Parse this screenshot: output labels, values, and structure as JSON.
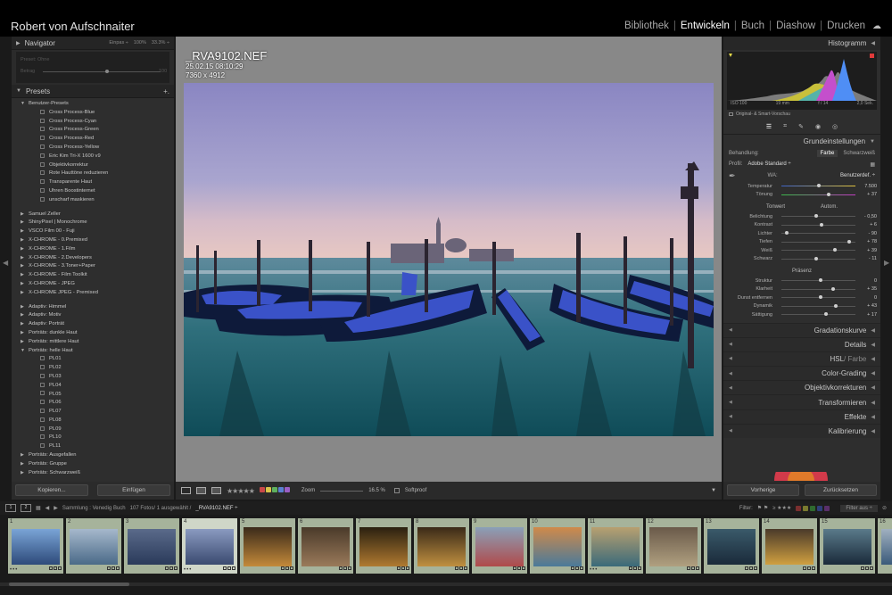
{
  "header": {
    "user_name": "Robert von Aufschnaiter",
    "modules": [
      "Bibliothek",
      "Entwickeln",
      "Buch",
      "Diashow",
      "Drucken"
    ],
    "active_module": "Entwickeln"
  },
  "navigator": {
    "title": "Navigator",
    "zoom_options": [
      "Einpas ÷",
      "100%",
      "33.3% ÷"
    ],
    "preview_label": "Preset: Ohne",
    "amount_label": "Betrag",
    "amount_value": "100"
  },
  "presets": {
    "title": "Presets",
    "add_label": "+.",
    "items": [
      {
        "type": "group",
        "label": "Benutzer-Presets",
        "open": true
      },
      {
        "type": "child",
        "label": "Cross Process-Blue"
      },
      {
        "type": "child",
        "label": "Cross Process-Cyan"
      },
      {
        "type": "child",
        "label": "Cross Process-Green"
      },
      {
        "type": "child",
        "label": "Cross Process-Red"
      },
      {
        "type": "child",
        "label": "Cross Process-Yellow"
      },
      {
        "type": "child",
        "label": "Eric Kim Tri-X 1600 v9"
      },
      {
        "type": "child",
        "label": "Objektivkorrektur"
      },
      {
        "type": "child",
        "label": "Rote Hauttöne reduzieren"
      },
      {
        "type": "child",
        "label": "Transparente Haut"
      },
      {
        "type": "child",
        "label": "Uhren Boostinternet"
      },
      {
        "type": "child",
        "label": "unscharf maskieren"
      },
      {
        "type": "gap"
      },
      {
        "type": "group",
        "label": "Samuel Zeller"
      },
      {
        "type": "group",
        "label": "ShinyPixel | Monochrome"
      },
      {
        "type": "group",
        "label": "VSCO Film 00 - Fuji"
      },
      {
        "type": "group",
        "label": "X-CHROME - 0.Premixed"
      },
      {
        "type": "group",
        "label": "X-CHROME - 1.Film"
      },
      {
        "type": "group",
        "label": "X-CHROME - 2.Developers"
      },
      {
        "type": "group",
        "label": "X-CHROME - 3.Toner+Paper"
      },
      {
        "type": "group",
        "label": "X-CHROME - Film Toolkit"
      },
      {
        "type": "group",
        "label": "X-CHROME - JPEG"
      },
      {
        "type": "group",
        "label": "X-CHROME JPEG - Premixed"
      },
      {
        "type": "gap"
      },
      {
        "type": "group",
        "label": "Adaptiv: Himmel"
      },
      {
        "type": "group",
        "label": "Adaptiv: Motiv"
      },
      {
        "type": "group",
        "label": "Adaptiv: Porträt"
      },
      {
        "type": "group",
        "label": "Porträts: dunkle Haut"
      },
      {
        "type": "group",
        "label": "Porträts: mittlere Haut"
      },
      {
        "type": "group",
        "label": "Porträts: helle Haut",
        "open": true
      },
      {
        "type": "child",
        "label": "PL01"
      },
      {
        "type": "child",
        "label": "PL02"
      },
      {
        "type": "child",
        "label": "PL03"
      },
      {
        "type": "child",
        "label": "PL04"
      },
      {
        "type": "child",
        "label": "PL05"
      },
      {
        "type": "child",
        "label": "PL06"
      },
      {
        "type": "child",
        "label": "PL07"
      },
      {
        "type": "child",
        "label": "PL08"
      },
      {
        "type": "child",
        "label": "PL09"
      },
      {
        "type": "child",
        "label": "PL10"
      },
      {
        "type": "child",
        "label": "PL11"
      },
      {
        "type": "group",
        "label": "Porträts: Ausgefallen"
      },
      {
        "type": "group",
        "label": "Porträts: Gruppe"
      },
      {
        "type": "group",
        "label": "Porträts: Schwarzweiß"
      }
    ],
    "copy_button": "Kopieren...",
    "paste_button": "Einfügen"
  },
  "photo_info": {
    "filename": "_RVA9102.NEF",
    "datetime": "25.02.15 08:10:29",
    "dimensions": "7360 x 4912"
  },
  "toolbar": {
    "zoom_label": "Zoom",
    "zoom_value": "16.5 %",
    "softproof_label": "Softproof",
    "stars": "★★★★★",
    "color_labels": [
      "#c94848",
      "#d9c34a",
      "#5eb05e",
      "#5a7fd0",
      "#9a5ec4"
    ]
  },
  "histogram": {
    "title": "Histogramm",
    "iso": "ISO 100",
    "focal": "19 mm",
    "aperture": "f / 14",
    "shutter": "2,0 Sek.",
    "source": "Original- & Smart-Vorschau"
  },
  "basic": {
    "title": "Grundeinstellungen",
    "treatment_label": "Behandlung:",
    "treatment_color": "Farbe",
    "treatment_bw": "Schwarzweiß",
    "profile_label": "Profil:",
    "profile_value": "Adobe Standard ÷",
    "wb_label": "WA:",
    "wb_value": "Benutzerdef. ÷",
    "tone_label": "Tonwert",
    "auto_label": "Autom.",
    "presence_label": "Präsenz",
    "wb_sliders": [
      {
        "label": "Temperatur",
        "value": "7.500",
        "pos": 0.48
      },
      {
        "label": "Tönung",
        "value": "+ 37",
        "pos": 0.62
      }
    ],
    "tone_sliders": [
      {
        "label": "Belichtung",
        "value": "- 0,50",
        "pos": 0.44
      },
      {
        "label": "Kontrast",
        "value": "+ 6",
        "pos": 0.52
      },
      {
        "label": "Lichter",
        "value": "- 90",
        "pos": 0.05
      },
      {
        "label": "Tiefen",
        "value": "+ 78",
        "pos": 0.89
      },
      {
        "label": "Weiß",
        "value": "+ 39",
        "pos": 0.7
      },
      {
        "label": "Schwarz",
        "value": "- 11",
        "pos": 0.44
      }
    ],
    "presence_sliders": [
      {
        "label": "Struktur",
        "value": "0",
        "pos": 0.5
      },
      {
        "label": "Klarheit",
        "value": "+ 35",
        "pos": 0.67
      },
      {
        "label": "Dunst entfernen",
        "value": "0",
        "pos": 0.5
      },
      {
        "label": "Dynamik",
        "value": "+ 43",
        "pos": 0.71
      },
      {
        "label": "Sättigung",
        "value": "+ 17",
        "pos": 0.58
      }
    ]
  },
  "collapsed_panels": [
    {
      "label": "Gradationskurve"
    },
    {
      "label": "Details"
    },
    {
      "label": "HSL",
      "suffix": "/ Farbe"
    },
    {
      "label": "Color-Grading"
    },
    {
      "label": "Objektivkorrekturen"
    },
    {
      "label": "Transformieren"
    },
    {
      "label": "Effekte"
    },
    {
      "label": "Kalibrierung"
    }
  ],
  "right_buttons": {
    "previous": "Vorherige",
    "reset": "Zurücksetzen"
  },
  "filmstrip_bar": {
    "view1": "1",
    "view2": "2",
    "source": "Sammlung : Venedig Buch",
    "count": "107 Fotos/ 1 ausgewählt /",
    "current": "_RVA9102.NEF ÷",
    "filter_label": "Filter:",
    "filter_value": "Filter aus ÷"
  },
  "filmstrip": [
    {
      "num": "1"
    },
    {
      "num": "2"
    },
    {
      "num": "3"
    },
    {
      "num": "4",
      "selected": true
    },
    {
      "num": "5"
    },
    {
      "num": "6"
    },
    {
      "num": "7"
    },
    {
      "num": "8"
    },
    {
      "num": "9"
    },
    {
      "num": "10"
    },
    {
      "num": "11"
    },
    {
      "num": "12"
    },
    {
      "num": "13"
    },
    {
      "num": "14"
    },
    {
      "num": "15"
    },
    {
      "num": "16"
    }
  ],
  "colors": {
    "accent": "#ffffff",
    "selected_cell": "#cfd6c8",
    "cell": "#a6b39b"
  }
}
